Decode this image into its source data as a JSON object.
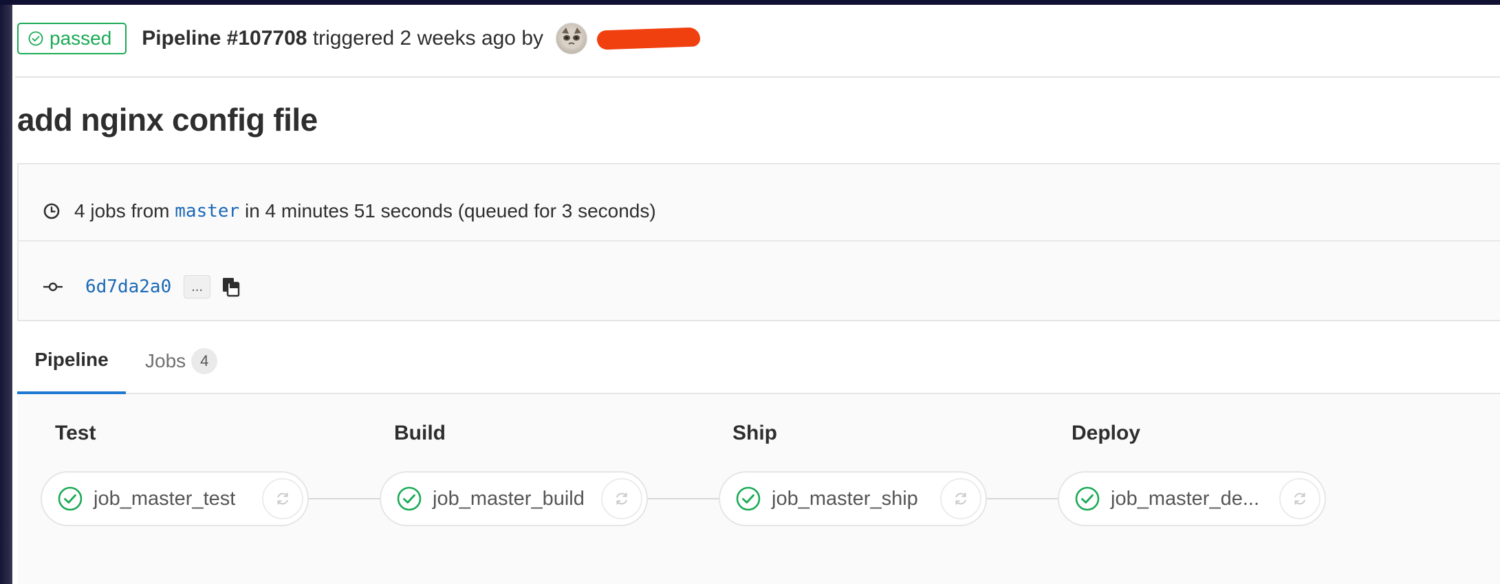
{
  "header": {
    "status_label": "passed",
    "pipeline_id": "Pipeline #107708",
    "triggered_text": "triggered 2 weeks ago by"
  },
  "commit": {
    "title": "add nginx config file",
    "sha": "6d7da2a0",
    "expand_label": "..."
  },
  "info": {
    "jobs_prefix": "4 jobs from",
    "branch": "master",
    "duration_text": "in 4 minutes 51 seconds (queued for 3 seconds)"
  },
  "tabs": {
    "pipeline_label": "Pipeline",
    "jobs_label": "Jobs",
    "jobs_count": "4"
  },
  "stages": [
    {
      "name": "Test",
      "job": "job_master_test",
      "status": "passed"
    },
    {
      "name": "Build",
      "job": "job_master_build",
      "status": "passed"
    },
    {
      "name": "Ship",
      "job": "job_master_ship",
      "status": "passed"
    },
    {
      "name": "Deploy",
      "job": "job_master_de...",
      "status": "passed"
    }
  ],
  "colors": {
    "success": "#1aaa55",
    "link": "#1b69b6",
    "tab_active": "#1f78d1",
    "redaction": "#f0400f"
  },
  "icons": {
    "status": "check-circle-icon",
    "clock": "clock-icon",
    "commit": "commit-icon",
    "copy": "clipboard-icon",
    "retry": "retry-icon"
  }
}
